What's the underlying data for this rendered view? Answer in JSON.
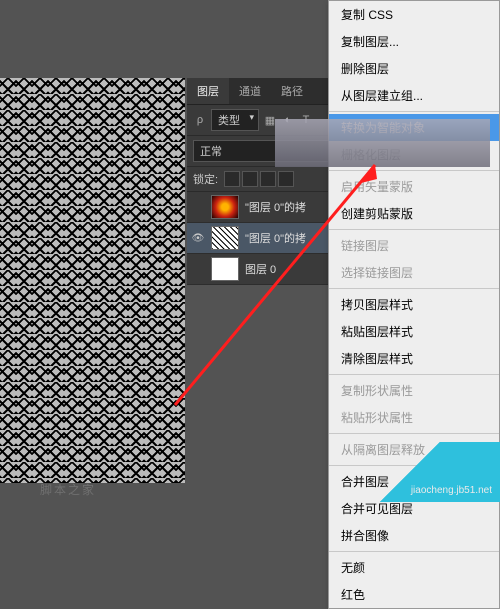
{
  "panel": {
    "tabs": {
      "layers": "图层",
      "channels": "通道",
      "paths": "路径"
    },
    "typeLabel": "类型",
    "blendMode": "正常",
    "lockLabel": "锁定:",
    "layerList": [
      {
        "name": "\"图层 0\"的拷",
        "thumb": "grad",
        "eye": false,
        "sel": false
      },
      {
        "name": "\"图层 0\"的拷",
        "thumb": "patt",
        "eye": true,
        "sel": true
      },
      {
        "name": "图层 0",
        "thumb": "white",
        "eye": false,
        "sel": false
      }
    ]
  },
  "menu": {
    "copyCSS": "复制 CSS",
    "dupLayer": "复制图层...",
    "delLayer": "删除图层",
    "groupFromLayer": "从图层建立组...",
    "convertSmart": "转换为智能对象",
    "rasterize": "栅格化图层",
    "enableVecMask": "启用矢量蒙版",
    "createClipMask": "创建剪贴蒙版",
    "linkLayers": "链接图层",
    "selectLinked": "选择链接图层",
    "copyStyle": "拷贝图层样式",
    "pasteStyle": "粘贴图层样式",
    "clearStyle": "清除图层样式",
    "copyShape": "复制形状属性",
    "pasteShape": "粘贴形状属性",
    "releaseIso": "从隔离图层释放",
    "mergeLayers": "合并图层",
    "mergeVisible": "合并可见图层",
    "flatten": "拼合图像",
    "noColor": "无颜",
    "red": "红色"
  },
  "watermark": "脚本之家",
  "corner": "jiaocheng.jb51.net"
}
